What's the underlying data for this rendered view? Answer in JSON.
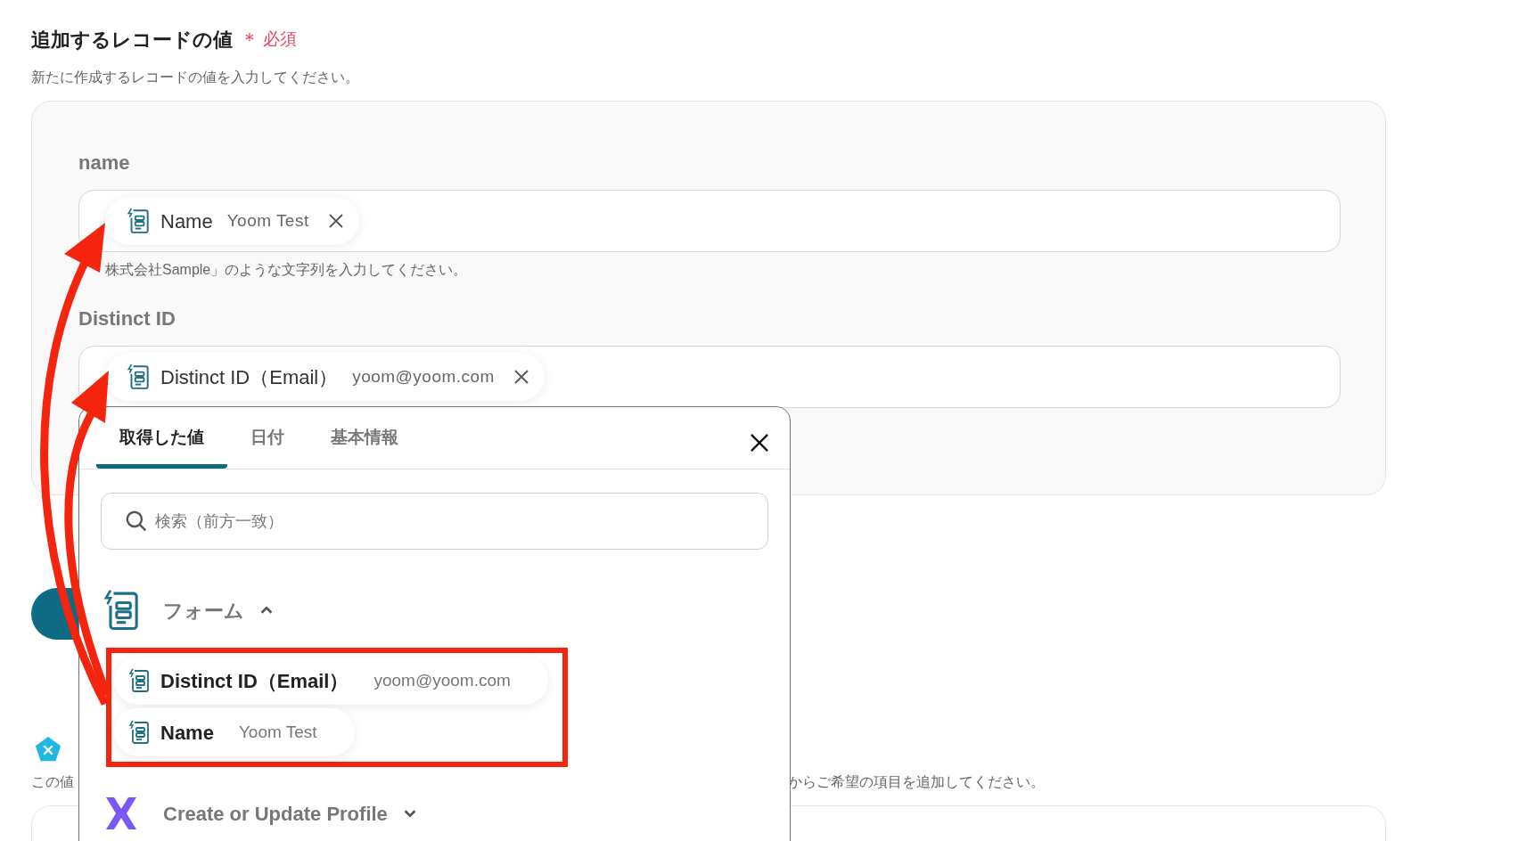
{
  "header": {
    "title": "追加するレコードの値",
    "required_mark": "＊",
    "required_label": "必須",
    "description": "新たに作成するレコードの値を入力してください。"
  },
  "fields": [
    {
      "label": "name",
      "chip": {
        "label": "Name",
        "value": "Yoom Test"
      },
      "hint": "株式会社Sample」のような文字列を入力してください。"
    },
    {
      "label": "Distinct ID",
      "chip": {
        "label": "Distinct ID（Email）",
        "value": "yoom@yoom.com"
      }
    }
  ],
  "popup": {
    "tabs": [
      {
        "label": "取得した値",
        "selected": true
      },
      {
        "label": "日付",
        "selected": false
      },
      {
        "label": "基本情報",
        "selected": false
      }
    ],
    "search": {
      "placeholder": "検索（前方一致）"
    },
    "sections": [
      {
        "kind": "form",
        "title": "フォーム",
        "expanded": true,
        "items": [
          {
            "label": "Distinct ID（Email）",
            "value": "yoom@yoom.com"
          },
          {
            "label": "Name",
            "value": "Yoom Test"
          }
        ]
      },
      {
        "kind": "app",
        "title": "Create or Update Profile",
        "expanded": false
      }
    ]
  },
  "below": {
    "description_start": "この値",
    "description_end": "からご希望の項目を追加してください。"
  }
}
